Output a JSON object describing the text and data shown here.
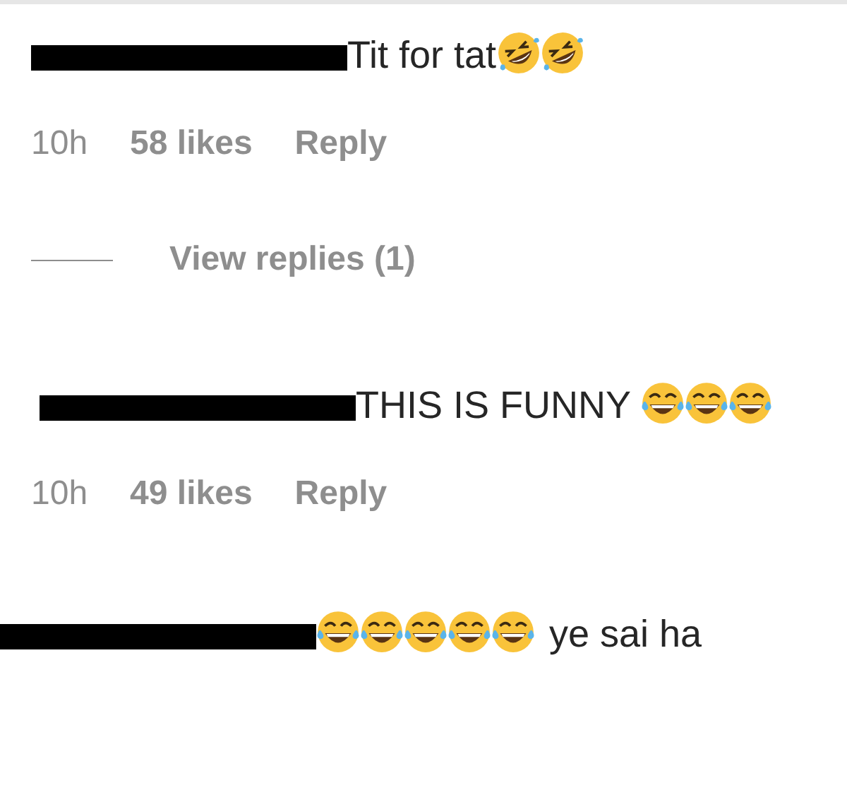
{
  "comments": [
    {
      "username_redacted": true,
      "text": "Tit for tat",
      "emojis": [
        {
          "kind": "rofl"
        },
        {
          "kind": "rofl"
        }
      ],
      "time": "10h",
      "likes": "58 likes",
      "reply": "Reply",
      "view_replies": "View replies (1)"
    },
    {
      "username_redacted": true,
      "text": "THIS IS FUNNY",
      "emojis": [
        {
          "kind": "joy"
        },
        {
          "kind": "joy"
        },
        {
          "kind": "joy"
        }
      ],
      "time": "10h",
      "likes": "49 likes",
      "reply": "Reply"
    },
    {
      "username_redacted": true,
      "emojis": [
        {
          "kind": "joy"
        },
        {
          "kind": "joy"
        },
        {
          "kind": "joy"
        },
        {
          "kind": "joy"
        },
        {
          "kind": "joy"
        }
      ],
      "text": "ye sai ha"
    }
  ]
}
